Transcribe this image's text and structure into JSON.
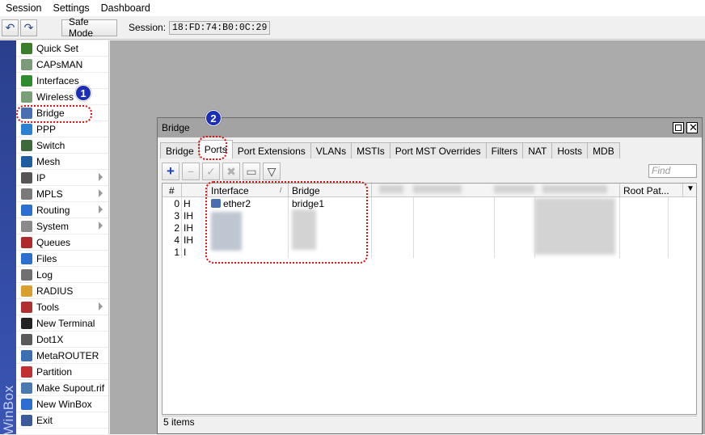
{
  "menu": [
    "Session",
    "Settings",
    "Dashboard"
  ],
  "toolbar": {
    "safe_mode": "Safe Mode",
    "session_label": "Session:",
    "session_value": "18:FD:74:B0:0C:29"
  },
  "app_name_vertical": "WinBox",
  "sidebar": {
    "items": [
      {
        "label": "Quick Set",
        "icon": "wand-icon",
        "color": "#3a7d2a",
        "submenu": false
      },
      {
        "label": "CAPsMAN",
        "icon": "antenna-icon",
        "color": "#7a9a7a",
        "submenu": false
      },
      {
        "label": "Interfaces",
        "icon": "interfaces-icon",
        "color": "#2e8b2e",
        "submenu": false
      },
      {
        "label": "Wireless",
        "icon": "wireless-icon",
        "color": "#7aa07a",
        "submenu": false
      },
      {
        "label": "Bridge",
        "icon": "bridge-icon",
        "color": "#4a6fb0",
        "submenu": false
      },
      {
        "label": "PPP",
        "icon": "ppp-icon",
        "color": "#2c7fd1",
        "submenu": false
      },
      {
        "label": "Switch",
        "icon": "switch-icon",
        "color": "#3c6a3c",
        "submenu": false
      },
      {
        "label": "Mesh",
        "icon": "mesh-icon",
        "color": "#1f5fa0",
        "submenu": false
      },
      {
        "label": "IP",
        "icon": "ip-icon",
        "color": "#555555",
        "submenu": true
      },
      {
        "label": "MPLS",
        "icon": "mpls-icon",
        "color": "#7a7a7a",
        "submenu": true
      },
      {
        "label": "Routing",
        "icon": "routing-icon",
        "color": "#2c6fd1",
        "submenu": true
      },
      {
        "label": "System",
        "icon": "gear-icon",
        "color": "#8a8a8a",
        "submenu": true
      },
      {
        "label": "Queues",
        "icon": "queues-icon",
        "color": "#b02a2a",
        "submenu": false
      },
      {
        "label": "Files",
        "icon": "folder-icon",
        "color": "#2c6fd1",
        "submenu": false
      },
      {
        "label": "Log",
        "icon": "log-icon",
        "color": "#707070",
        "submenu": false
      },
      {
        "label": "RADIUS",
        "icon": "users-icon",
        "color": "#d9a030",
        "submenu": false
      },
      {
        "label": "Tools",
        "icon": "tools-icon",
        "color": "#b03030",
        "submenu": true
      },
      {
        "label": "New Terminal",
        "icon": "terminal-icon",
        "color": "#222222",
        "submenu": false
      },
      {
        "label": "Dot1X",
        "icon": "dot1x-icon",
        "color": "#5a5a5a",
        "submenu": false
      },
      {
        "label": "MetaROUTER",
        "icon": "metarouter-icon",
        "color": "#3a6fb0",
        "submenu": false
      },
      {
        "label": "Partition",
        "icon": "partition-icon",
        "color": "#c03030",
        "submenu": false
      },
      {
        "label": "Make Supout.rif",
        "icon": "supout-icon",
        "color": "#4a7ab0",
        "submenu": false
      },
      {
        "label": "New WinBox",
        "icon": "winbox-icon",
        "color": "#2c6fd1",
        "submenu": false
      },
      {
        "label": "Exit",
        "icon": "exit-icon",
        "color": "#3a5a9a",
        "submenu": false
      }
    ]
  },
  "window": {
    "title": "Bridge",
    "tabs": [
      "Bridge",
      "Ports",
      "Port Extensions",
      "VLANs",
      "MSTIs",
      "Port MST Overrides",
      "Filters",
      "NAT",
      "Hosts",
      "MDB"
    ],
    "active_tab": "Ports",
    "find_placeholder": "Find",
    "columns": [
      "#",
      "Interface",
      "Bridge",
      "Root Pat..."
    ],
    "rows": [
      {
        "num": "0",
        "flags": "H",
        "interface": "ether2",
        "bridge": "bridge1"
      },
      {
        "num": "3",
        "flags": "IH",
        "interface": "",
        "bridge": ""
      },
      {
        "num": "2",
        "flags": "IH",
        "interface": "",
        "bridge": ""
      },
      {
        "num": "4",
        "flags": "IH",
        "interface": "",
        "bridge": ""
      },
      {
        "num": "1",
        "flags": "I",
        "interface": "",
        "bridge": ""
      }
    ],
    "status": "5 items"
  },
  "annotations": {
    "badge1": "1",
    "badge2": "2",
    "color": "#d41414",
    "badge_color": "#1a2fb5"
  }
}
